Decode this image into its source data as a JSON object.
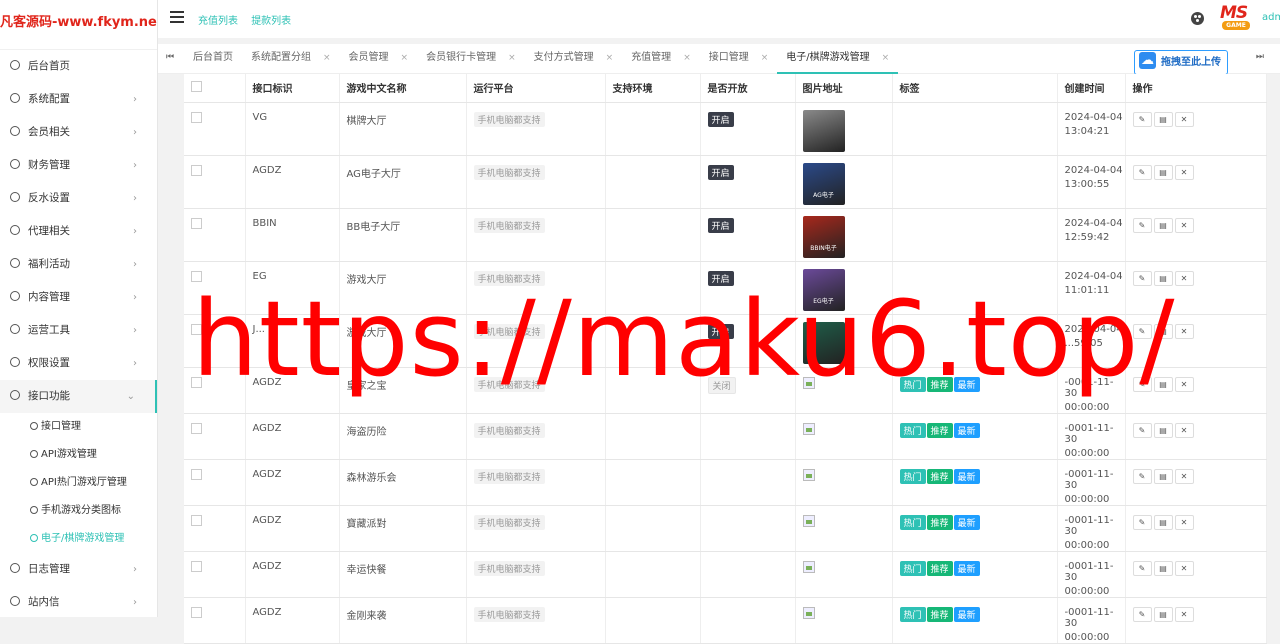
{
  "sidebar": {
    "logo": "凡客源码-www.fkym.net",
    "items": [
      {
        "label": "后台首页",
        "chevron": ""
      },
      {
        "label": "系统配置",
        "chevron": "›"
      },
      {
        "label": "会员相关",
        "chevron": "›"
      },
      {
        "label": "财务管理",
        "chevron": "›"
      },
      {
        "label": "反水设置",
        "chevron": "›"
      },
      {
        "label": "代理相关",
        "chevron": "›"
      },
      {
        "label": "福利活动",
        "chevron": "›"
      },
      {
        "label": "内容管理",
        "chevron": "›"
      },
      {
        "label": "运营工具",
        "chevron": "›"
      },
      {
        "label": "权限设置",
        "chevron": "›"
      },
      {
        "label": "接口功能",
        "chevron": "⌄"
      }
    ],
    "submenu": [
      {
        "label": "接口管理"
      },
      {
        "label": "API游戏管理"
      },
      {
        "label": "API热门游戏厅管理"
      },
      {
        "label": "手机游戏分类图标"
      },
      {
        "label": "电子/棋牌游戏管理"
      }
    ],
    "after": [
      {
        "label": "日志管理",
        "chevron": "›"
      },
      {
        "label": "站内信",
        "chevron": "›"
      }
    ]
  },
  "topbar": {
    "nav": [
      "充值列表",
      "提款列表"
    ],
    "brand_top": "MS",
    "brand_bottom": "GAME",
    "admin": "admin"
  },
  "tabs": {
    "first_label": "⏮",
    "last_label": "⏭",
    "items": [
      {
        "label": "后台首页",
        "close": ""
      },
      {
        "label": "系统配置分组",
        "close": "×"
      },
      {
        "label": "会员管理",
        "close": "×"
      },
      {
        "label": "会员银行卡管理",
        "close": "×"
      },
      {
        "label": "支付方式管理",
        "close": "×"
      },
      {
        "label": "充值管理",
        "close": "×"
      },
      {
        "label": "接口管理",
        "close": "×"
      },
      {
        "label": "电子/棋牌游戏管理",
        "close": "×"
      }
    ],
    "upload_label": "拖拽至此上传"
  },
  "table": {
    "headers": [
      "",
      "接口标识",
      "游戏中文名称",
      "运行平台",
      "支持环境",
      "是否开放",
      "图片地址",
      "标签",
      "创建时间",
      "操作"
    ],
    "platform_label": "手机电脑都支持",
    "open_label": "开启",
    "closed_label": "关闭",
    "tags": {
      "hot": "热门",
      "rec": "推荐",
      "new": "最新"
    },
    "action_icons": {
      "edit": "✎",
      "copy": "▤",
      "delete": "✕"
    },
    "rows": [
      {
        "code": "VG",
        "name": "棋牌大厅",
        "open": "开启",
        "image": "thumb",
        "thumb_color": "#8a8a8a",
        "thumb_text": "",
        "tags": false,
        "date": "2024-04-04",
        "time": "13:04:21"
      },
      {
        "code": "AGDZ",
        "name": "AG电子大厅",
        "open": "开启",
        "image": "thumb",
        "thumb_color": "#2b4a8a",
        "thumb_text": "AG电子",
        "tags": false,
        "date": "2024-04-04",
        "time": "13:00:55"
      },
      {
        "code": "BBIN",
        "name": "BB电子大厅",
        "open": "开启",
        "image": "thumb",
        "thumb_color": "#a8281c",
        "thumb_text": "BBIN电子",
        "tags": false,
        "date": "2024-04-04",
        "time": "12:59:42"
      },
      {
        "code": "EG",
        "name": "游戏大厅",
        "open": "开启",
        "image": "thumb",
        "thumb_color": "#6b4a9a",
        "thumb_text": "EG电子",
        "tags": false,
        "date": "2024-04-04",
        "time": "11:01:11"
      },
      {
        "code": "J...",
        "name": "游戏大厅",
        "open": "开启",
        "image": "thumb",
        "thumb_color": "#1f5f4a",
        "thumb_text": "",
        "tags": false,
        "date": "2024-04-04",
        "time": "...59:05"
      },
      {
        "code": "AGDZ",
        "name": "皇家之宝",
        "open": "关闭",
        "image": "broken",
        "thumb_color": "",
        "thumb_text": "",
        "tags": true,
        "date": "-0001-11-30",
        "time": "00:00:00"
      },
      {
        "code": "AGDZ",
        "name": "海盗历险",
        "open": "",
        "image": "broken",
        "thumb_color": "",
        "thumb_text": "",
        "tags": true,
        "date": "-0001-11-30",
        "time": "00:00:00"
      },
      {
        "code": "AGDZ",
        "name": "森林游乐会",
        "open": "",
        "image": "broken",
        "thumb_color": "",
        "thumb_text": "",
        "tags": true,
        "date": "-0001-11-30",
        "time": "00:00:00"
      },
      {
        "code": "AGDZ",
        "name": "寶藏派對",
        "open": "",
        "image": "broken",
        "thumb_color": "",
        "thumb_text": "",
        "tags": true,
        "date": "-0001-11-30",
        "time": "00:00:00"
      },
      {
        "code": "AGDZ",
        "name": "幸运快餐",
        "open": "",
        "image": "broken",
        "thumb_color": "",
        "thumb_text": "",
        "tags": true,
        "date": "-0001-11-30",
        "time": "00:00:00"
      },
      {
        "code": "AGDZ",
        "name": "金刚来袭",
        "open": "",
        "image": "broken",
        "thumb_color": "",
        "thumb_text": "",
        "tags": true,
        "date": "-0001-11-30",
        "time": "00:00:00"
      }
    ]
  },
  "watermark": "https://maku6.top/"
}
